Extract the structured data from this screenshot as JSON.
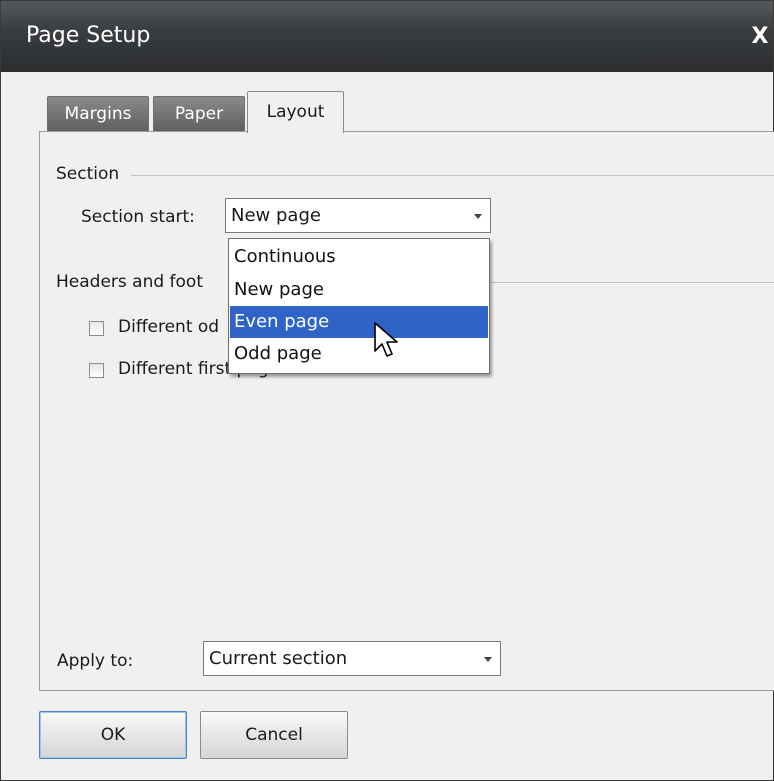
{
  "dialog": {
    "title": "Page Setup",
    "close_label": "X"
  },
  "tabs": [
    {
      "label": "Margins"
    },
    {
      "label": "Paper"
    },
    {
      "label": "Layout"
    }
  ],
  "section": {
    "group_label": "Section",
    "start_label": "Section start:",
    "start_value": "New page",
    "options": [
      "Continuous",
      "New page",
      "Even page",
      "Odd page"
    ],
    "highlighted_option": "Even page"
  },
  "headers_footers": {
    "group_label": "Headers and foot",
    "different_odd_even_label": "Different od",
    "different_first_page_label": "Different first page",
    "different_odd_even_checked": false,
    "different_first_page_checked": false
  },
  "apply_to": {
    "label": "Apply to:",
    "value": "Current section"
  },
  "buttons": {
    "ok_label": "OK",
    "cancel_label": "Cancel"
  },
  "colors": {
    "titlebar": "#3b3e41",
    "selection": "#2f63c5"
  }
}
